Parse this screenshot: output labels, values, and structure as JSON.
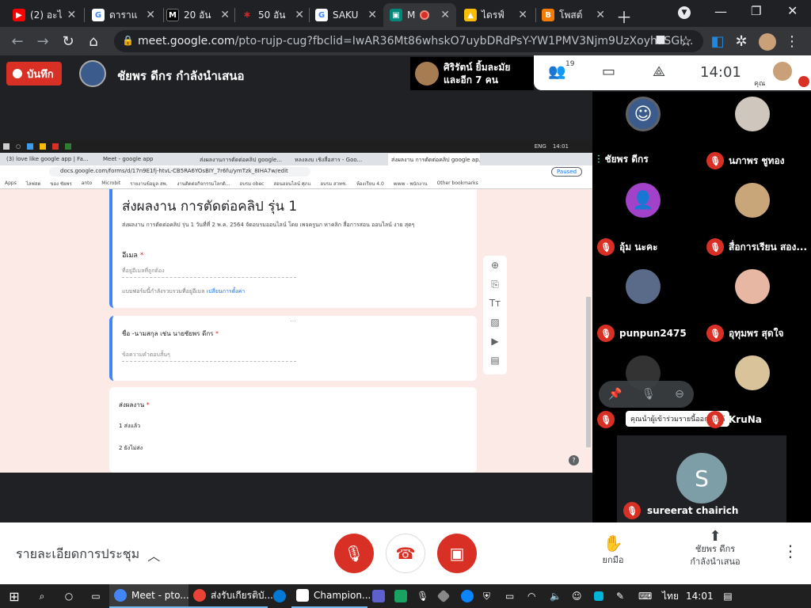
{
  "browser": {
    "tabs": [
      {
        "label": "(2) อะไ",
        "icon": "youtube-icon",
        "color": "#ff0000"
      },
      {
        "label": "ดาราแ",
        "icon": "google-icon",
        "color": "#4285f4"
      },
      {
        "label": "20 อัน",
        "icon": "m-icon",
        "color": "#000000"
      },
      {
        "label": "50 อัน",
        "icon": "star-icon",
        "color": "#c62828"
      },
      {
        "label": "SAKU",
        "icon": "google-icon",
        "color": "#4285f4"
      },
      {
        "label": "M",
        "icon": "meet-icon",
        "color": "#00897b"
      },
      {
        "label": "ไดรฟ์",
        "icon": "drive-icon",
        "color": "#fbbc04"
      },
      {
        "label": "โพสต์",
        "icon": "blogger-icon",
        "color": "#f57c00"
      }
    ],
    "url_domain": "meet.google.com",
    "url_path": "/pto-rujp-cug?fbclid=IwAR36Mt86whskO7uybDRdPsY-YW1PMV3Njm9UzXoyhaSGl..."
  },
  "meet": {
    "record_label": "บันทึก",
    "presenter": "ชัยพร ดีกร กำลังนำเสนอ",
    "speaker_line1": "ศิริรัตน์ ยิ้มละมัย",
    "speaker_line2": "และอีก 7 คน",
    "participant_count": "19",
    "time": "14:01",
    "self_label": "คุณ"
  },
  "shared": {
    "taskbar_time": "14:01",
    "taskbar_lang": "ENG",
    "inner_tabs": [
      "(3) love like google app | Fa...",
      "Meet - google app",
      "ส่งผลงานการตัดต่อคลิป google...",
      "หลงลงบ เชิงสื่อสาร - Goo...",
      "ส่งผลงาน การตัดต่อคลิป google ap..."
    ],
    "inner_url": "docs.google.com/forms/d/17n9E1fj-htvL-CB5RA6YOsBIY_7r6fu/ymTzk_8IHA7w/edit",
    "paused": "Paused",
    "bookmarks": [
      "Apps",
      "ไลฟสด",
      "ของ ชัยพร",
      "anto",
      "Microbit",
      "รายงานข้อมูล สพ.",
      "งานติดต่อกิจกรรมโลกดิ...",
      "อบรม obec",
      "สอนออนไลน์ ศุภแ",
      "อบรม สวทช.",
      "ห้องเรียน 4.0",
      "www - พนักงาน",
      "Other bookmarks"
    ],
    "form_title": "ส่งผลงาน การตัดต่อคลิป รุ่น 1",
    "form_desc": "ส่งผลงาน การตัดต่อคลิป รุ่น 1 วันที่ที่ 2 พ.ค. 2564 จัดอบรมออนไลน์ โดย เพจครูนก หาคลิก สื่อการสอน ออนไลน์ งาย สุดๆ",
    "email_label": "อีเมล",
    "email_placeholder": "ที่อยู่อีเมลที่ถูกต้อง",
    "email_note": "แบบฟอร์มนี้กำลังรวบรวมที่อยู่อีเมล",
    "email_link": "เปลี่ยนการตั้งค่า",
    "q2_label": "ชื่อ -นามสกุล เช่น นายชัยพร ดีกร",
    "q2_placeholder": "ข้อความคำตอบสั้นๆ",
    "q3_label": "ส่งผลงาน",
    "q3_opt1": "1   ส่งแล้ว",
    "q3_opt2": "2   ยังไม่ส่ง",
    "required": "*",
    "help": "?"
  },
  "participants": [
    {
      "name": "ชัยพร ดีกร",
      "status": "speaking",
      "avatar_color": "#3b5b8c"
    },
    {
      "name": "นภาพร ชูทอง",
      "status": "muted",
      "avatar_color": "#cfc7bd"
    },
    {
      "name": "อุ้ม นะคะ",
      "status": "muted",
      "avatar_color": "#a142c9"
    },
    {
      "name": "สื่อการเรียน สอง...",
      "status": "muted",
      "avatar_color": "#c9a57a"
    },
    {
      "name": "punpun2475",
      "status": "muted",
      "avatar_color": "#5a6b8a"
    },
    {
      "name": "อุทุมพร สุดใจ",
      "status": "muted",
      "avatar_color": "#e7b7a3"
    },
    {
      "name": "",
      "status": "muted",
      "avatar_color": "#333333"
    },
    {
      "name": "KruNa",
      "status": "muted",
      "avatar_color": "#d9c39a"
    }
  ],
  "tile_tooltip": "คุณนำผู้เข้าร่วมรายนี้ออกไม่ได้",
  "last_participant": {
    "name": "sureerat chairich",
    "initial": "S",
    "color": "#7d9ea6"
  },
  "bottom": {
    "details_label": "รายละเอียดการประชุม",
    "raise_hand": "ยกมือ",
    "presenting_line1": "ชัยพร ดีกร",
    "presenting_line2": "กำลังนำเสนอ"
  },
  "taskbar": {
    "items": [
      "Meet - pto...",
      "ส่งรับเกียรติบั...",
      "Champion..."
    ],
    "lang": "ไทย",
    "time": "14:01"
  },
  "colors": {
    "danger": "#d93025",
    "meet_dark": "#202124"
  }
}
